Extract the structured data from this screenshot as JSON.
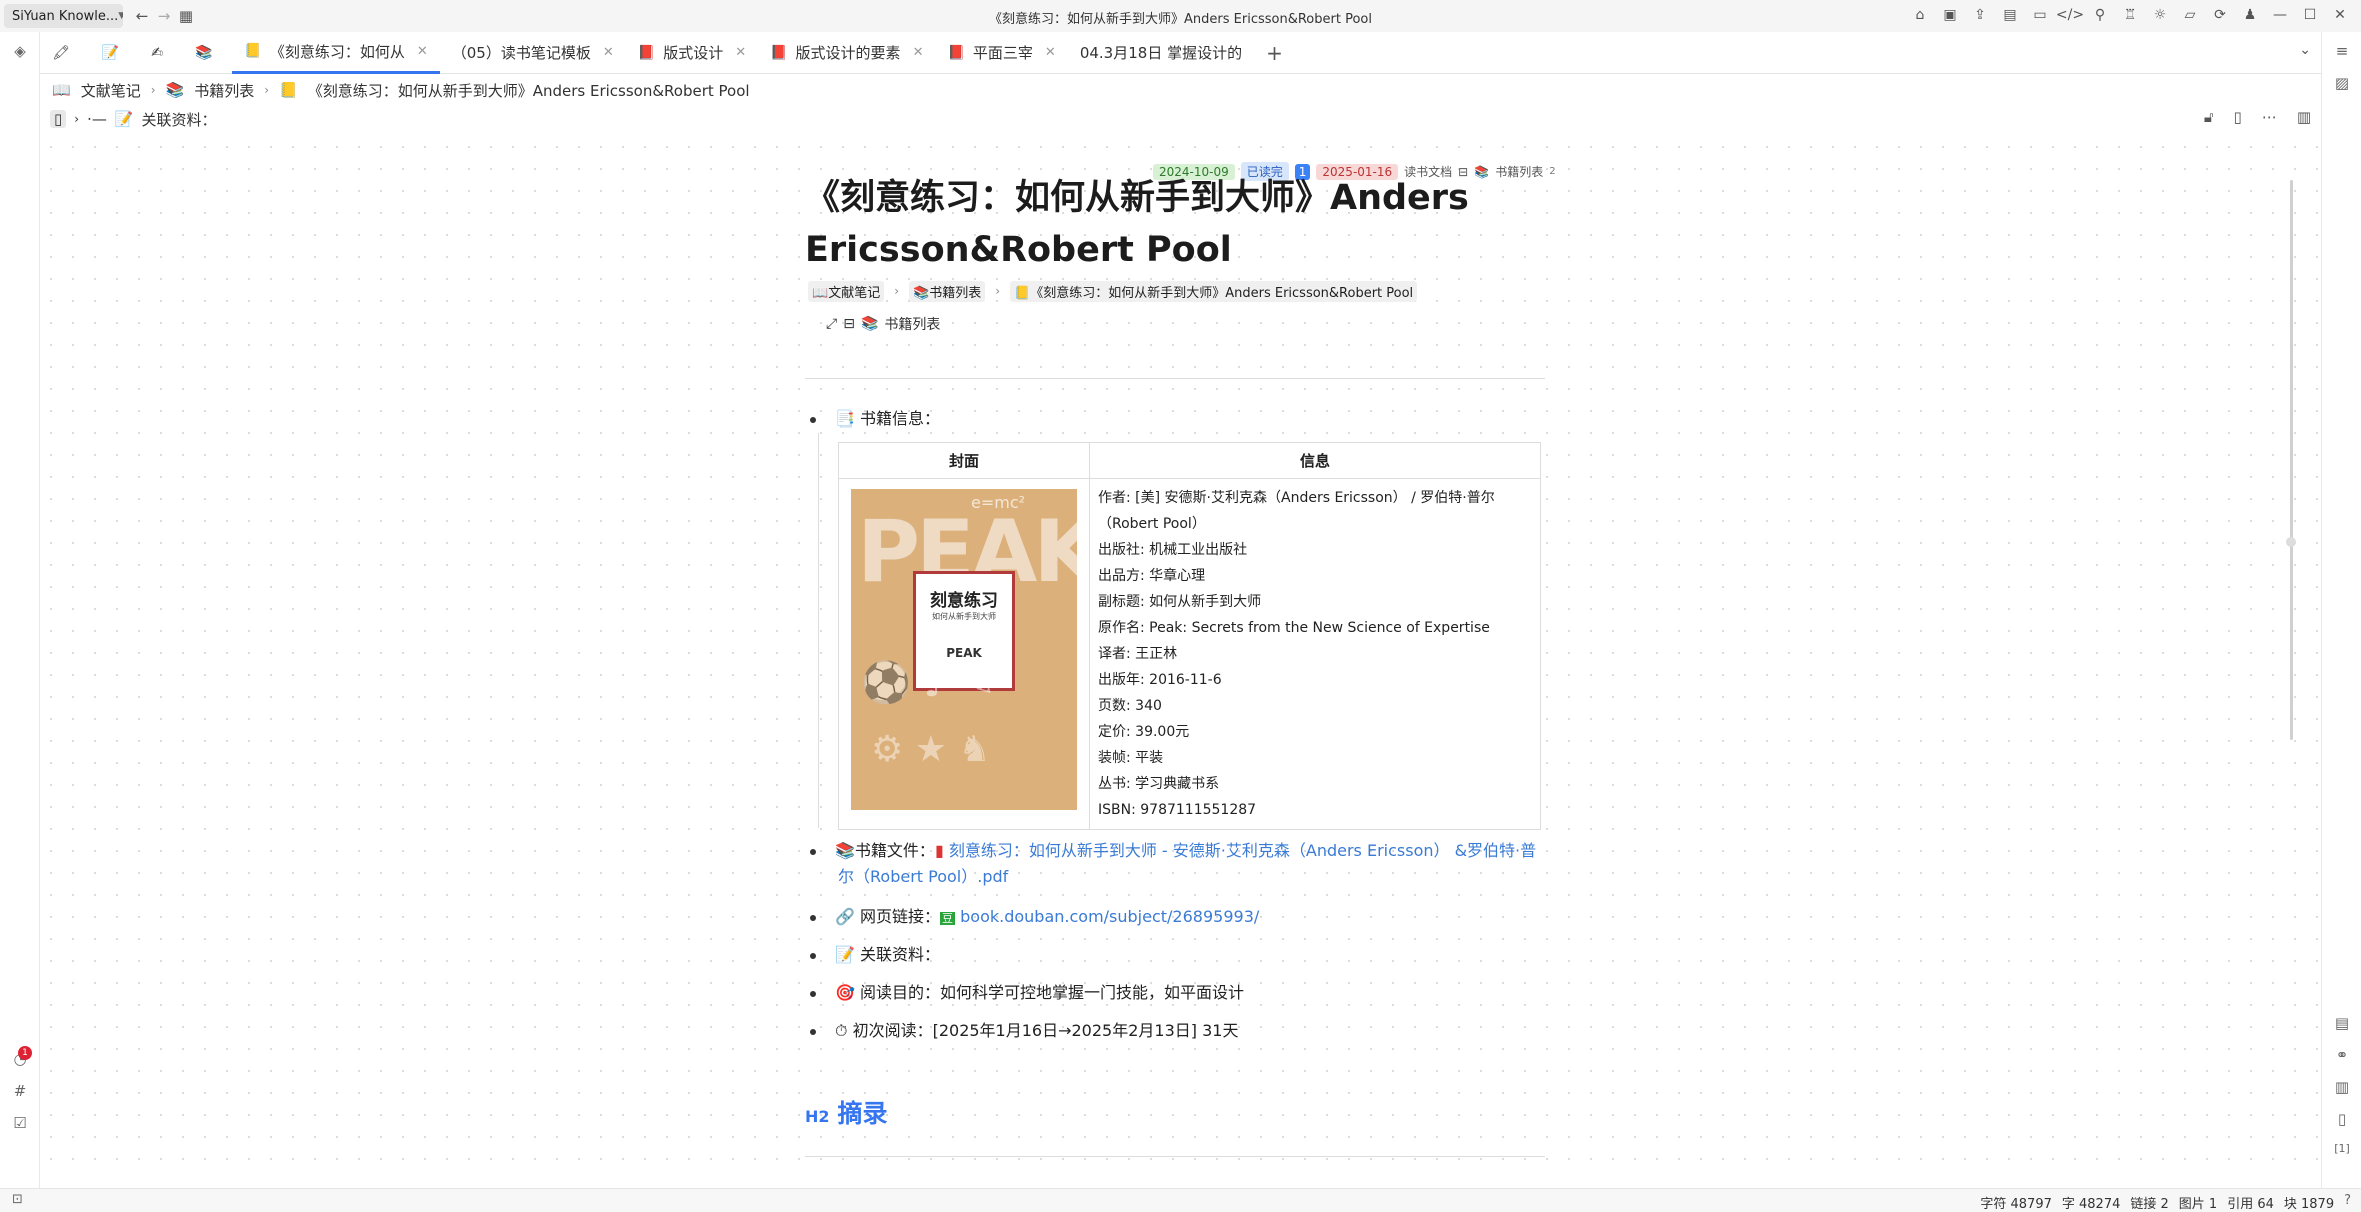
{
  "app": {
    "workspace": "SiYuan Knowle...",
    "window_title": "《刻意练习：如何从新手到大师》Anders Ericsson&Robert Pool"
  },
  "tabs": [
    {
      "label": "",
      "icon": "🖍"
    },
    {
      "label": "",
      "icon": "📝"
    },
    {
      "label": "",
      "icon": "✍"
    },
    {
      "label": "",
      "icon": "📚"
    },
    {
      "label": "《刻意练习：如何从",
      "icon": "📒",
      "active": true
    },
    {
      "label": "（05）读书笔记模板",
      "icon": ""
    },
    {
      "label": "版式设计",
      "icon": "📕"
    },
    {
      "label": "版式设计的要素",
      "icon": "📕"
    },
    {
      "label": "平面三宰",
      "icon": "📕"
    },
    {
      "label": "04.3月18日 掌握设计的",
      "icon": ""
    }
  ],
  "breadcrumb": [
    "文献笔记",
    "书籍列表",
    "《刻意练习：如何从新手到大师》Anders Ericsson&Robert Pool"
  ],
  "protyle_top": {
    "label": "关联资料："
  },
  "tags": {
    "date1": "2024-10-09",
    "status": "已读完",
    "num": "1",
    "date2": "2025-01-16",
    "type": "读书文档",
    "list": "书籍列表",
    "count": "2"
  },
  "doc": {
    "title": "《刻意练习：如何从新手到大师》Anders Ericsson&Robert Pool",
    "path": [
      "文献笔记",
      "书籍列表",
      "《刻意练习：如何从新手到大师》Anders Ericsson&Robert Pool"
    ],
    "sub_link": "书籍列表",
    "section_book_info": "书籍信息：",
    "table_headers": [
      "封面",
      "信息"
    ],
    "cover": {
      "title": "刻意练习",
      "subtitle": "如何从新手到大师",
      "peak": "PEAK"
    },
    "info_lines": [
      "作者: [美] 安德斯·艾利克森（Anders Ericsson） / 罗伯特·普尔",
      "（Robert Pool）",
      "出版社: 机械工业出版社",
      "出品方: 华章心理",
      "副标题: 如何从新手到大师",
      "原作名: Peak: Secrets from the New Science of Expertise",
      "译者: 王正林",
      "出版年: 2016-11-6",
      "页数: 340",
      "定价: 39.00元",
      "装帧: 平装",
      "丛书: 学习典藏书系",
      "ISBN: 9787111551287"
    ],
    "file_label": "书籍文件：",
    "file_link_1": "刻意练习：如何从新手到大师 - 安德斯·艾利克森（Anders Ericsson） &罗伯特·普",
    "file_link_2": "尔（Robert Pool）.pdf",
    "web_label": "网页链接：",
    "web_link": "book.douban.com/subject/26895993/",
    "related_label": "关联资料：",
    "purpose_label": "阅读目的：",
    "purpose_text": "如何科学可控地掌握一门技能，如平面设计",
    "first_read_label": "初次阅读：",
    "first_read_text": "[2025年1月16日→2025年2月13日] 31天",
    "h2_tag": "H2",
    "h2": "摘录"
  },
  "status": {
    "chars": "字符 48797",
    "words": "字 48274",
    "links": "链接 2",
    "images": "图片 1",
    "refs": "引用 64",
    "blocks": "块 1879"
  },
  "notification_count": "1"
}
